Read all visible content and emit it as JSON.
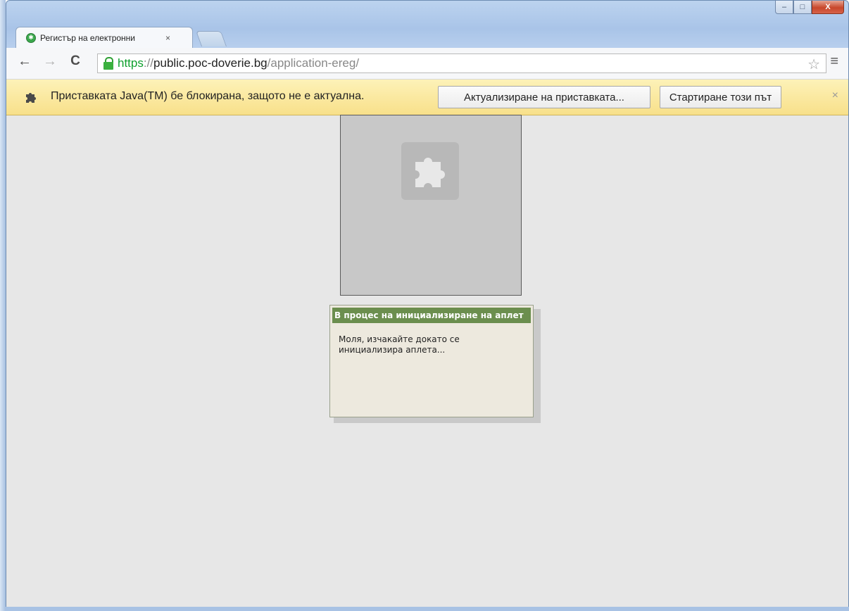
{
  "window": {
    "controls": {
      "minimize": "–",
      "maximize": "□",
      "close": "X"
    }
  },
  "tab": {
    "title": "Регистър на електронни",
    "close": "×"
  },
  "toolbar": {
    "back": "←",
    "forward": "→",
    "reload": "C",
    "url_scheme": "https",
    "url_sep": "://",
    "url_host": "public.poc-doverie.bg",
    "url_path": "/application-ereg/",
    "star": "☆",
    "menu": "≡"
  },
  "infobar": {
    "message": "Приставката Java(TM) бе блокирана, защото не е актуална.",
    "update_button": "Актуализиране на приставката...",
    "run_button": "Стартиране този път",
    "close": "×"
  },
  "applet": {
    "header": "В процес на инициализиране на аплет",
    "message": "Моля, изчакайте докато се инициализира аплета..."
  },
  "colors": {
    "infobar_bg": "#f8e08a",
    "content_bg": "#e7e7e7",
    "applet_header": "#6b8e4e",
    "secure_green": "#0d9f2c"
  }
}
